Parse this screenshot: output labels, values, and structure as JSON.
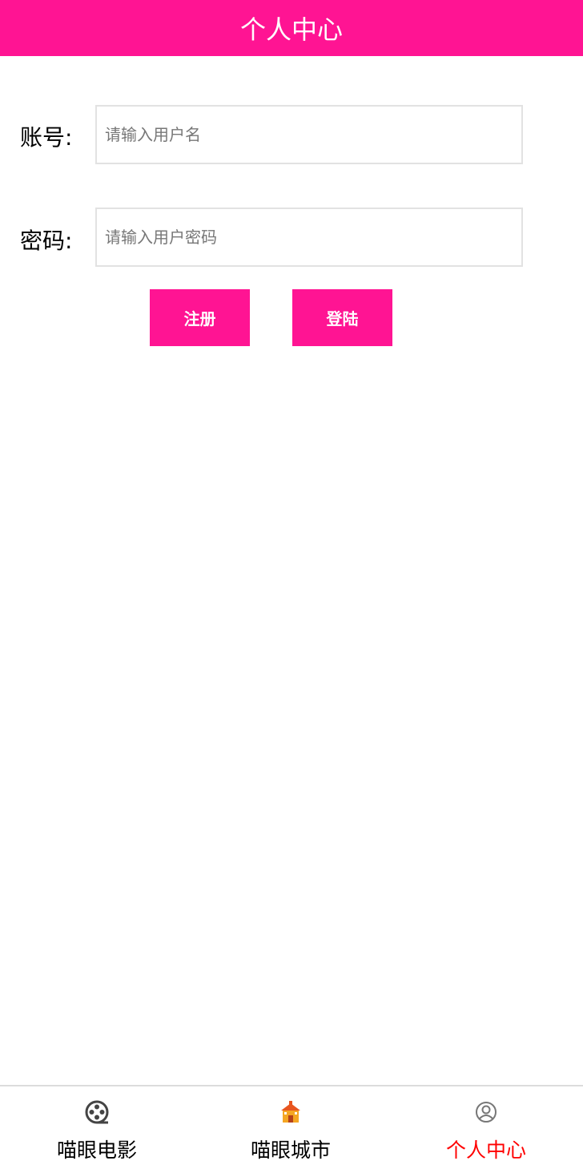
{
  "header": {
    "title": "个人中心"
  },
  "form": {
    "account_label": "账号:",
    "account_placeholder": "请输入用户名",
    "password_label": "密码:",
    "password_placeholder": "请输入用户密码",
    "register_label": "注册",
    "login_label": "登陆"
  },
  "tabbar": {
    "items": [
      {
        "label": "喵眼电影",
        "icon": "film-reel-icon",
        "active": false
      },
      {
        "label": "喵眼城市",
        "icon": "building-icon",
        "active": false
      },
      {
        "label": "个人中心",
        "icon": "user-icon",
        "active": true
      }
    ]
  },
  "colors": {
    "accent": "#ff1493",
    "active_tab": "#ff0000"
  }
}
